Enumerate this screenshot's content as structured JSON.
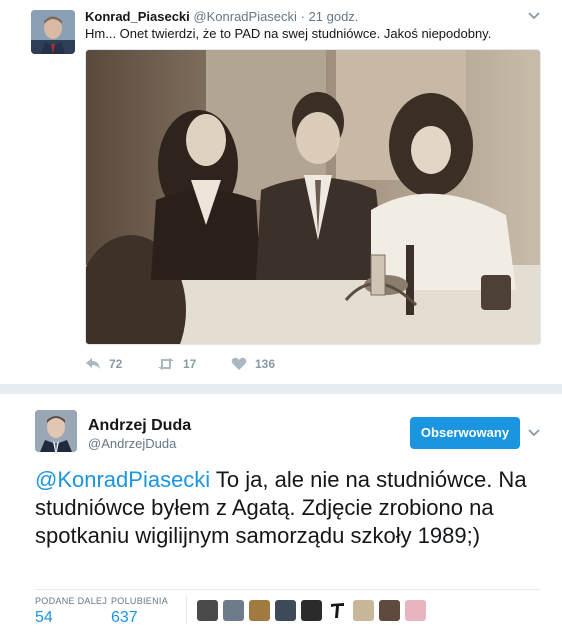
{
  "tweet1": {
    "author_name": "Konrad_Piasecki",
    "author_handle": "@KonradPiasecki",
    "separator": "·",
    "time": "21 godz.",
    "text": "Hm... Onet twierdzi, że to PAD na swej studniówce. Jakoś niepodobny.",
    "actions": {
      "reply_count": "72",
      "retweet_count": "17",
      "like_count": "136"
    }
  },
  "tweet2": {
    "author_name": "Andrzej Duda",
    "author_handle": "@AndrzejDuda",
    "follow_label": "Obserwowany",
    "mention": "@KonradPiasecki",
    "text": " To ja, ale nie na studniówce. Na studniówce byłem z Agatą. Zdjęcie zrobiono na spotkaniu wigilijnym samorządu szkoły 1989;)",
    "stats": {
      "retweets_label": "PODANE DALEJ",
      "retweets_value": "54",
      "likes_label": "POLUBIENIA",
      "likes_value": "637"
    }
  },
  "colors": {
    "accent": "#1b95e0",
    "muted": "#657786",
    "divider": "#e6ecf0"
  },
  "icons": [
    "chevron-down-icon",
    "reply-icon",
    "retweet-icon",
    "heart-icon"
  ]
}
